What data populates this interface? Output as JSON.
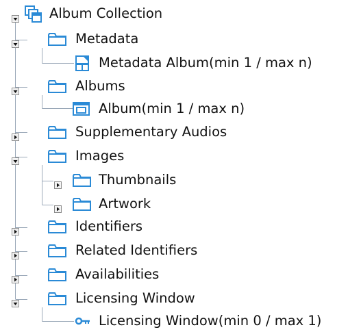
{
  "tree": {
    "root": {
      "label": "Album Collection",
      "icon": "album-collection-icon",
      "expanded": true
    },
    "metadata": {
      "label": "Metadata",
      "icon": "folder-icon",
      "expanded": true,
      "child_label": "Metadata Album(min 1 / max n)",
      "child_icon": "metadata-album-icon"
    },
    "albums": {
      "label": "Albums",
      "icon": "folder-icon",
      "expanded": true,
      "child_label": "Album(min 1 / max n)",
      "child_icon": "album-icon"
    },
    "supplementary_audios": {
      "label": "Supplementary Audios",
      "icon": "folder-icon",
      "expanded": false
    },
    "images": {
      "label": "Images",
      "icon": "folder-icon",
      "expanded": true,
      "thumbnails_label": "Thumbnails",
      "artwork_label": "Artwork"
    },
    "identifiers": {
      "label": "Identifiers",
      "icon": "folder-icon",
      "expanded": false
    },
    "related_identifiers": {
      "label": "Related Identifiers",
      "icon": "folder-icon",
      "expanded": false
    },
    "availabilities": {
      "label": "Availabilities",
      "icon": "folder-icon",
      "expanded": false
    },
    "licensing_window": {
      "label": "Licensing Window",
      "icon": "folder-icon",
      "expanded": true,
      "child_label": "Licensing Window(min 0 / max 1)",
      "child_icon": "key-icon"
    }
  },
  "colors": {
    "folder_stroke": "#2a8ad6",
    "folder_fill": "#ffffff",
    "guide_line": "#9aa8b8",
    "toggle_border": "#8a8a8a",
    "toggle_glyph": "#111111"
  }
}
